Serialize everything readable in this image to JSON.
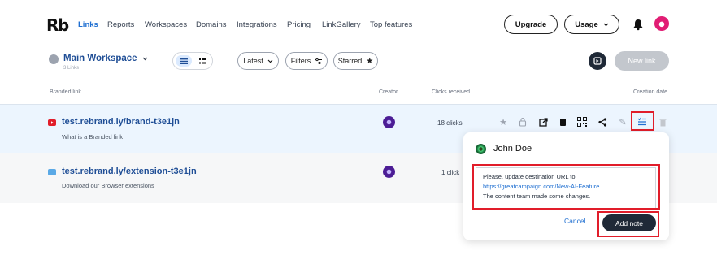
{
  "brand": {
    "logo_text": "Rb"
  },
  "nav": {
    "items": [
      "Links",
      "Reports",
      "Workspaces",
      "Domains",
      "Integrations",
      "Pricing",
      "LinkGallery",
      "Top features"
    ],
    "active": "Links"
  },
  "header_actions": {
    "upgrade_label": "Upgrade",
    "usage_label": "Usage"
  },
  "workspace": {
    "title": "Main Workspace",
    "subtitle": "3 Links"
  },
  "toolbar": {
    "sort_label": "Latest",
    "filters_label": "Filters",
    "starred_label": "Starred",
    "new_link_label": "New link"
  },
  "table": {
    "headers": {
      "branded_link": "Branded link",
      "creator": "Creator",
      "clicks": "Clicks received",
      "date": "Creation date"
    },
    "rows": [
      {
        "link": "test.rebrand.ly/brand-t3e1jn",
        "description": "What is a Branded link",
        "clicks": "18 clicks",
        "icon": "youtube-icon"
      },
      {
        "link": "test.rebrand.ly/extension-t3e1jn",
        "description": "Download our Browser extensions",
        "clicks": "1 click",
        "icon": "rebrandly-icon"
      }
    ]
  },
  "note_popover": {
    "author": "John Doe",
    "lines": [
      "Please, update destination URL to:",
      "https://greatcampaign.com/New-AI-Feature",
      "The content team made some changes."
    ],
    "cancel_label": "Cancel",
    "add_label": "Add note"
  },
  "colors": {
    "accent": "#1f6fd1",
    "highlight": "#e11d2a",
    "row_selected": "#ecf5fe"
  }
}
